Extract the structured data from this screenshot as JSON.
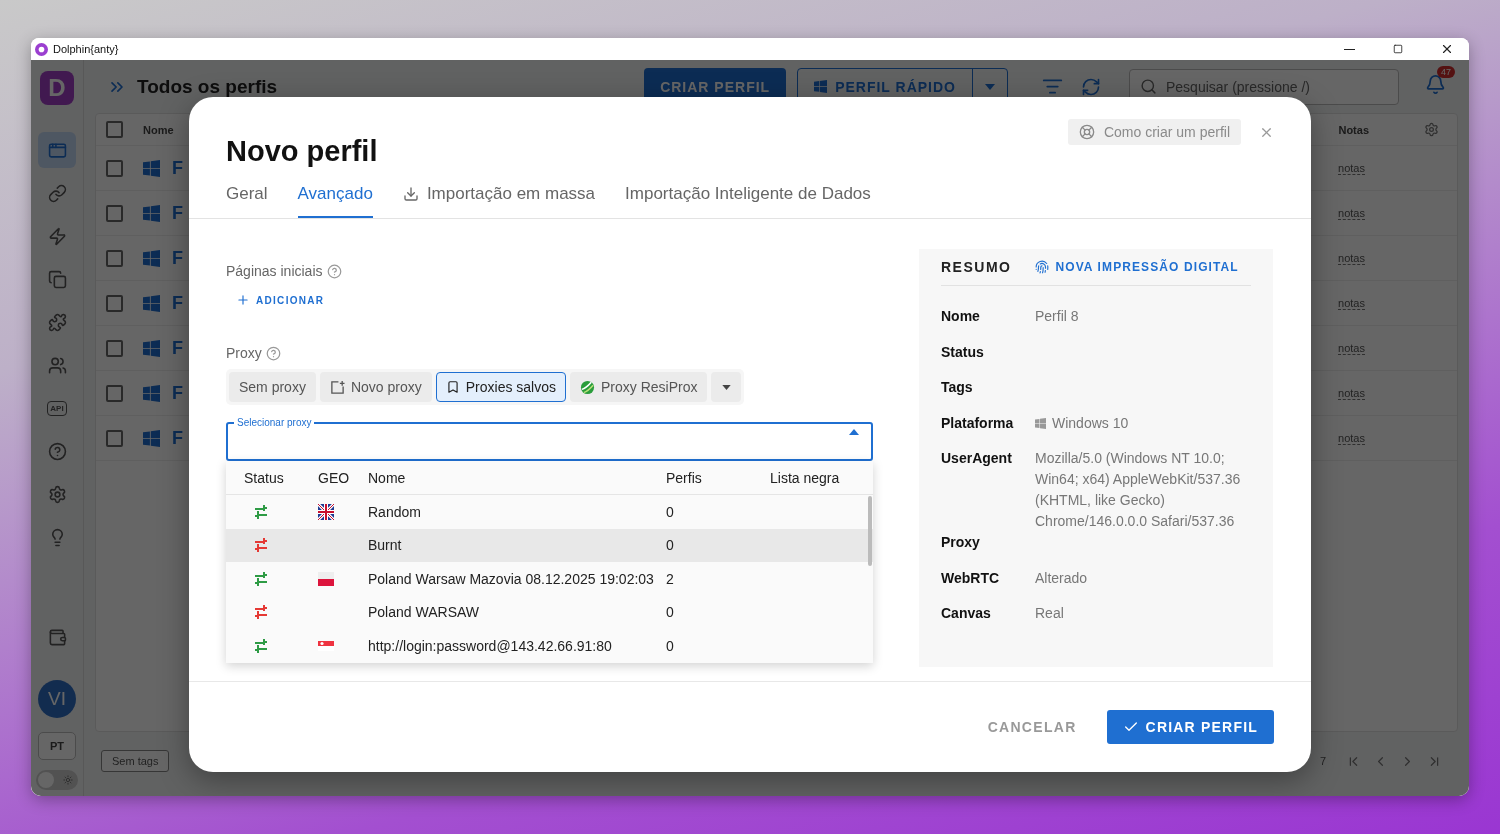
{
  "window": {
    "title": "Dolphin{anty}"
  },
  "sidebar": {
    "logo": "D",
    "items": [
      {
        "kind": "browser",
        "selected": true
      },
      {
        "kind": "link",
        "selected": false
      },
      {
        "kind": "zap",
        "selected": false
      },
      {
        "kind": "copy",
        "selected": false
      },
      {
        "kind": "puzzle",
        "selected": false
      },
      {
        "kind": "users",
        "selected": false
      },
      {
        "kind": "api",
        "label": "API",
        "selected": false
      },
      {
        "kind": "help",
        "selected": false
      },
      {
        "kind": "settings",
        "selected": false
      },
      {
        "kind": "bulb",
        "selected": false
      }
    ],
    "avatar": "VI",
    "language": "PT",
    "theme_toggle": {
      "on": false
    }
  },
  "header": {
    "title": "Todos os perfis",
    "create_button": "CRIAR PERFIL",
    "quick_button": "PERFIL RÁPIDO",
    "search": {
      "placeholder": "Pesquisar (pressione /)"
    },
    "notifications": "47"
  },
  "table": {
    "select_all": {
      "checked": false
    },
    "columns": [
      "Nome",
      "Notas"
    ],
    "rows": [
      {
        "checked": false,
        "name": "F",
        "notes": "notas"
      },
      {
        "checked": false,
        "name": "F",
        "notes": "notas"
      },
      {
        "checked": false,
        "name": "F",
        "notes": "notas"
      },
      {
        "checked": false,
        "name": "F",
        "notes": "notas"
      },
      {
        "checked": false,
        "name": "F",
        "notes": "notas"
      },
      {
        "checked": false,
        "name": "F",
        "notes": "notas"
      },
      {
        "checked": false,
        "name": "F",
        "notes": "notas"
      }
    ]
  },
  "footer": {
    "tags_button": "Sem tags",
    "page_info": "7"
  },
  "modal": {
    "title": "Novo perfil",
    "help_button": "Como criar um perfil",
    "tabs": [
      {
        "label": "Geral",
        "selected": false,
        "kind": "plain"
      },
      {
        "label": "Avançado",
        "selected": true,
        "kind": "plain"
      },
      {
        "label": "Importação em massa",
        "selected": false,
        "kind": "download"
      },
      {
        "label": "Importação Inteligente de Dados",
        "selected": false,
        "kind": "plain"
      }
    ],
    "start_pages": {
      "label": "Páginas iniciais",
      "add_button": "ADICIONAR"
    },
    "proxy": {
      "label": "Proxy",
      "options": [
        {
          "label": "Sem proxy",
          "kind": "plain",
          "selected": false
        },
        {
          "label": "Novo proxy",
          "kind": "new",
          "selected": false
        },
        {
          "label": "Proxies salvos",
          "kind": "saved",
          "selected": true
        },
        {
          "label": "Proxy ResiProx",
          "kind": "resiprox",
          "selected": false
        }
      ],
      "select": {
        "label": "Selecionar proxy",
        "expanded": true
      },
      "list": {
        "columns": [
          "Status",
          "GEO",
          "Nome",
          "Perfis",
          "Lista negra"
        ],
        "rows": [
          {
            "color": "#2e9b45",
            "kind": "uk",
            "name": "Random",
            "profiles": "0",
            "hovered": false
          },
          {
            "color": "#e53935",
            "kind": "none",
            "name": "Burnt",
            "profiles": "0",
            "hovered": true
          },
          {
            "color": "#2e9b45",
            "kind": "pl",
            "name": "Poland Warsaw Mazovia 08.12.2025 19:02:03",
            "profiles": "2",
            "hovered": false
          },
          {
            "color": "#e53935",
            "kind": "none",
            "name": "Poland WARSAW",
            "profiles": "0",
            "hovered": false
          },
          {
            "color": "#2e9b45",
            "kind": "sg",
            "name": "http://login:password@143.42.66.91:80",
            "profiles": "0",
            "hovered": false
          }
        ]
      }
    },
    "summary": {
      "title": "RESUMO",
      "fingerprint_button": "NOVA IMPRESSÃO DIGITAL",
      "rows": [
        {
          "label": "Nome",
          "value": "Perfil 8",
          "kind": "text"
        },
        {
          "label": "Status",
          "kind": "empty"
        },
        {
          "label": "Tags",
          "kind": "empty"
        },
        {
          "label": "Plataforma",
          "value": "Windows 10",
          "kind": "windows"
        },
        {
          "label": "UserAgent",
          "value": "Mozilla/5.0 (Windows NT 10.0; Win64; x64) AppleWebKit/537.36 (KHTML, like Gecko) Chrome/146.0.0.0 Safari/537.36",
          "kind": "text"
        },
        {
          "label": "Proxy",
          "kind": "empty"
        },
        {
          "label": "WebRTC",
          "value": "Alterado",
          "kind": "text"
        },
        {
          "label": "Canvas",
          "value": "Real",
          "kind": "text"
        }
      ]
    },
    "cancel_button": "CANCELAR",
    "create_button": "CRIAR PERFIL"
  }
}
